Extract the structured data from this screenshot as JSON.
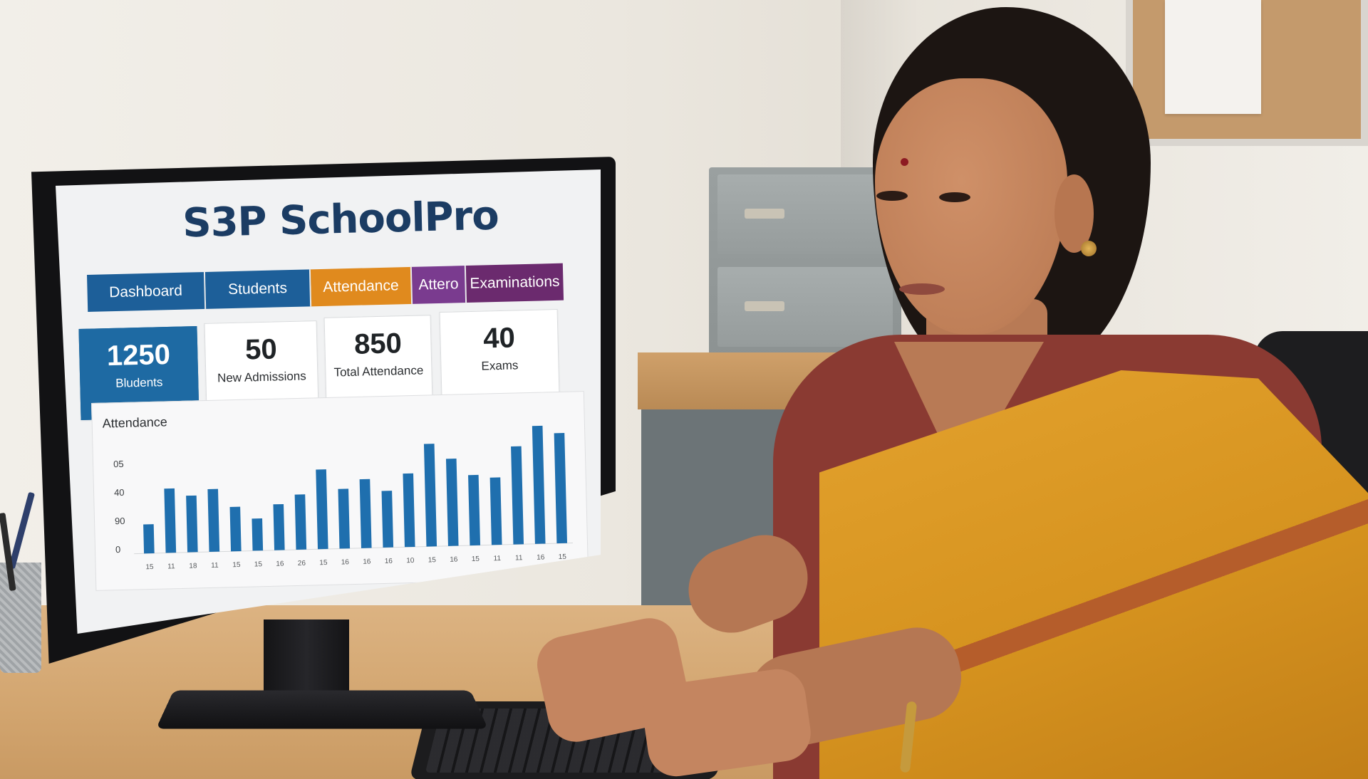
{
  "app": {
    "title": "S3P SchoolPro"
  },
  "nav": {
    "tabs": [
      {
        "label": "Dashboard",
        "color": "#1d5f99"
      },
      {
        "label": "Students",
        "color": "#1d5f99"
      },
      {
        "label": "Attendance",
        "color": "#e08a1e"
      },
      {
        "label": "Attero",
        "color": "#7a3b8f"
      },
      {
        "label": "Examinations",
        "color": "#6b2a6e"
      }
    ]
  },
  "stats": [
    {
      "value": "1250",
      "label": "Bludents",
      "highlight": true
    },
    {
      "value": "50",
      "label": "New Admissions",
      "highlight": false
    },
    {
      "value": "850",
      "label": "Total Attendance",
      "highlight": false
    },
    {
      "value": "40",
      "label": "Exams",
      "highlight": false
    }
  ],
  "chart_data": {
    "type": "bar",
    "title": "Attendance",
    "yticks": [
      "05",
      "40",
      "90",
      "0"
    ],
    "categories": [
      "15",
      "11",
      "18",
      "11",
      "15",
      "15",
      "16",
      "26",
      "15",
      "16",
      "16",
      "16",
      "10",
      "15",
      "16",
      "15",
      "11",
      "11",
      "16",
      "15"
    ],
    "values": [
      19,
      42,
      37,
      41,
      29,
      21,
      30,
      36,
      52,
      39,
      45,
      37,
      48,
      67,
      57,
      46,
      44,
      64,
      77,
      72
    ],
    "ylim": [
      0,
      80
    ],
    "bar_color": "#1f6fae"
  }
}
